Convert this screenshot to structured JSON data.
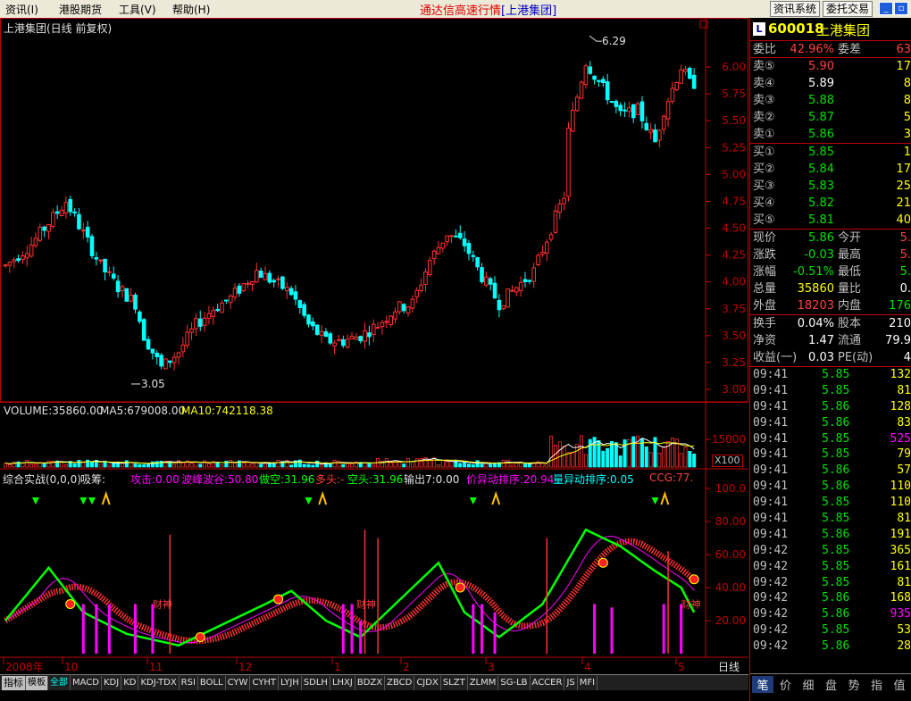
{
  "menu": {
    "items": [
      "资讯(I)",
      "港股期货",
      "工具(V)",
      "帮助(H)"
    ],
    "app_title": "通达信高速行情",
    "app_subtitle": "[上港集团]",
    "btn_info": "资讯系统",
    "btn_trade": "委托交易"
  },
  "main_chart": {
    "title": "上港集团(日线 前复权)",
    "y_ticks": [
      "6.00",
      "5.75",
      "5.50",
      "5.25",
      "5.00",
      "4.75",
      "4.50",
      "4.25",
      "4.00",
      "3.75",
      "3.50",
      "3.25",
      "3.00"
    ],
    "high_label": "6.29",
    "low_label": "3.05"
  },
  "volume_chart": {
    "label_volume": "VOLUME:35860.00",
    "label_ma5": "MA5:679008.00",
    "label_ma10": "MA10:742118.38",
    "y_tick": "15000",
    "unit": "X100"
  },
  "indicator_chart": {
    "labels": [
      {
        "text": "综合实战(0,0,0)",
        "color": "#E0E0E0"
      },
      {
        "text": "吸筹:",
        "color": "#E0E0E0"
      },
      {
        "text": "攻击:0.00",
        "color": "#FF00FF"
      },
      {
        "text": "波峰波谷:50.80",
        "color": "#FF00FF"
      },
      {
        "text": "做空:31.96",
        "color": "#00FF00"
      },
      {
        "text": "多头:-",
        "color": "#FF4040"
      },
      {
        "text": "空头:31.96",
        "color": "#00FF00"
      },
      {
        "text": "输出7:0.00",
        "color": "#E0E0E0"
      },
      {
        "text": "价异动排序:20.94",
        "color": "#FF00FF"
      },
      {
        "text": "量异动排序:0.05",
        "color": "#00FFFF"
      },
      {
        "text": "CCG:77.",
        "color": "#FF4040"
      }
    ],
    "y_ticks": [
      "100.0",
      "80.00",
      "60.00",
      "40.00",
      "20.00"
    ],
    "annotation": "财神"
  },
  "x_axis": {
    "labels": [
      "2008年",
      "10",
      "11",
      "12",
      "1",
      "2",
      "3",
      "4",
      "5"
    ],
    "period": "日线"
  },
  "stock": {
    "badge": "L",
    "code": "600018",
    "name": "上港集团"
  },
  "quote": {
    "weibi_label": "委比",
    "weibi_value": "42.96%",
    "weicha_label": "委差",
    "weicha_value": "63",
    "sells": [
      {
        "label": "卖⑤",
        "price": "5.90",
        "vol": "17",
        "color": "#FF4040"
      },
      {
        "label": "卖④",
        "price": "5.89",
        "vol": "8",
        "color": "#FFFFFF"
      },
      {
        "label": "卖③",
        "price": "5.88",
        "vol": "8",
        "color": "#00E000"
      },
      {
        "label": "卖②",
        "price": "5.87",
        "vol": "5",
        "color": "#00E000"
      },
      {
        "label": "卖①",
        "price": "5.86",
        "vol": "3",
        "color": "#00E000"
      }
    ],
    "buys": [
      {
        "label": "买①",
        "price": "5.85",
        "vol": "1",
        "color": "#00E000"
      },
      {
        "label": "买②",
        "price": "5.84",
        "vol": "17",
        "color": "#00E000"
      },
      {
        "label": "买③",
        "price": "5.83",
        "vol": "25",
        "color": "#00E000"
      },
      {
        "label": "买④",
        "price": "5.82",
        "vol": "21",
        "color": "#00E000"
      },
      {
        "label": "买⑤",
        "price": "5.81",
        "vol": "40",
        "color": "#00E000"
      }
    ],
    "stats": [
      {
        "l1": "现价",
        "v1": "5.86",
        "c1": "#00E000",
        "l2": "今开",
        "v2": "5.",
        "c2": "#FF4040"
      },
      {
        "l1": "涨跌",
        "v1": "-0.03",
        "c1": "#00E000",
        "l2": "最高",
        "v2": "5.",
        "c2": "#FF4040"
      },
      {
        "l1": "涨幅",
        "v1": "-0.51%",
        "c1": "#00E000",
        "l2": "最低",
        "v2": "5.",
        "c2": "#00E000"
      },
      {
        "l1": "总量",
        "v1": "35860",
        "c1": "#FFFF00",
        "l2": "量比",
        "v2": "0.",
        "c2": "#FFFFFF"
      },
      {
        "l1": "外盘",
        "v1": "18203",
        "c1": "#FF4040",
        "l2": "内盘",
        "v2": "176",
        "c2": "#00E000"
      }
    ],
    "stats2": [
      {
        "l1": "换手",
        "v1": "0.04%",
        "c1": "#FFFFFF",
        "l2": "股本",
        "v2": "210",
        "c2": "#FFFFFF"
      },
      {
        "l1": "净资",
        "v1": "1.47",
        "c1": "#FFFFFF",
        "l2": "流通",
        "v2": "79.9",
        "c2": "#FFFFFF"
      },
      {
        "l1": "收益(一)",
        "v1": "0.03",
        "c1": "#FFFFFF",
        "l2": "PE(动)",
        "v2": "4",
        "c2": "#FFFFFF"
      }
    ]
  },
  "ticks": [
    {
      "t": "09:41",
      "p": "5.85",
      "v": "132",
      "vc": "#FFFF00"
    },
    {
      "t": "09:41",
      "p": "5.85",
      "v": "81",
      "vc": "#FFFF00"
    },
    {
      "t": "09:41",
      "p": "5.86",
      "v": "128",
      "vc": "#FFFF00"
    },
    {
      "t": "09:41",
      "p": "5.86",
      "v": "83",
      "vc": "#FFFF00"
    },
    {
      "t": "09:41",
      "p": "5.85",
      "v": "525",
      "vc": "#FF00FF"
    },
    {
      "t": "09:41",
      "p": "5.85",
      "v": "79",
      "vc": "#FFFF00"
    },
    {
      "t": "09:41",
      "p": "5.86",
      "v": "57",
      "vc": "#FFFF00"
    },
    {
      "t": "09:41",
      "p": "5.86",
      "v": "110",
      "vc": "#FFFF00"
    },
    {
      "t": "09:41",
      "p": "5.85",
      "v": "110",
      "vc": "#FFFF00"
    },
    {
      "t": "09:41",
      "p": "5.85",
      "v": "81",
      "vc": "#FFFF00"
    },
    {
      "t": "09:41",
      "p": "5.86",
      "v": "191",
      "vc": "#FFFF00"
    },
    {
      "t": "09:42",
      "p": "5.85",
      "v": "365",
      "vc": "#FFFF00"
    },
    {
      "t": "09:42",
      "p": "5.85",
      "v": "161",
      "vc": "#FFFF00"
    },
    {
      "t": "09:42",
      "p": "5.85",
      "v": "81",
      "vc": "#FFFF00"
    },
    {
      "t": "09:42",
      "p": "5.86",
      "v": "168",
      "vc": "#FFFF00"
    },
    {
      "t": "09:42",
      "p": "5.86",
      "v": "935",
      "vc": "#FF00FF"
    },
    {
      "t": "09:42",
      "p": "5.85",
      "v": "53",
      "vc": "#FFFF00"
    },
    {
      "t": "09:42",
      "p": "5.86",
      "v": "28",
      "vc": "#FFFF00"
    }
  ],
  "right_tabs": [
    "笔",
    "价",
    "细",
    "盘",
    "势",
    "指",
    "值"
  ],
  "bottom_tabs": [
    "指标",
    "模板",
    "全部",
    "MACD",
    "KDJ",
    "KD",
    "KDJ-TDX",
    "RSI",
    "BOLL",
    "CYW",
    "CYHT",
    "LYJH",
    "SDLH",
    "LHXJ",
    "BDZX",
    "ZBCD",
    "CJDX",
    "SLZT",
    "ZLMM",
    "SG-LB",
    "ACCER",
    "JS",
    "MFI"
  ],
  "colors": {
    "up": "#FF3030",
    "down": "#00FFFF",
    "axis": "#C00000",
    "ma5": "#FFFFFF",
    "ma10": "#FFFF00"
  }
}
